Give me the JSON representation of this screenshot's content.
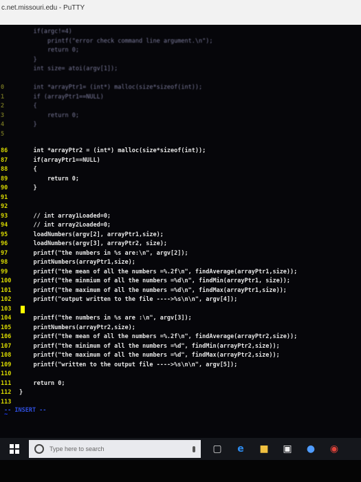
{
  "window": {
    "title": "c.net.missouri.edu - PuTTY"
  },
  "faded_lines": [
    {
      "ln": "",
      "text": "    if(argc!=4)"
    },
    {
      "ln": "",
      "text": "        printf(\"error check command line argument.\\n\");"
    },
    {
      "ln": "",
      "text": "        return 0;"
    },
    {
      "ln": "",
      "text": "    }"
    },
    {
      "ln": "",
      "text": "    int size= atoi(argv[1]);"
    },
    {
      "ln": "",
      "text": ""
    },
    {
      "ln": "0",
      "text": "    int *arrayPtr1= (int*) malloc(size*sizeof(int));"
    },
    {
      "ln": "1",
      "text": "    if (arrayPtr1==NULL)"
    },
    {
      "ln": "2",
      "text": "    {"
    },
    {
      "ln": "3",
      "text": "        return 0;"
    },
    {
      "ln": "4",
      "text": "    }"
    },
    {
      "ln": "5",
      "text": ""
    }
  ],
  "lines": [
    {
      "ln": "86",
      "text": "    int *arrayPtr2 = (int*) malloc(size*sizeof(int));"
    },
    {
      "ln": "87",
      "text": "    if(arrayPtr1==NULL)"
    },
    {
      "ln": "88",
      "text": "    {"
    },
    {
      "ln": "89",
      "text": "        return 0;"
    },
    {
      "ln": "90",
      "text": "    }"
    },
    {
      "ln": "91",
      "text": ""
    },
    {
      "ln": "92",
      "text": ""
    },
    {
      "ln": "93",
      "text": "    // int array1Loaded=0;"
    },
    {
      "ln": "94",
      "text": "    // int array2Loaded=0;"
    },
    {
      "ln": "95",
      "text": "    loadNumbers(argv[2], arrayPtr1,size);"
    },
    {
      "ln": "96",
      "text": "    loadNumbers(argv[3], arrayPtr2, size);"
    },
    {
      "ln": "97",
      "text": "    printf(\"the numbers in %s are:\\n\", argv[2]);"
    },
    {
      "ln": "98",
      "text": "    printNumbers(arrayPtr1,size);"
    },
    {
      "ln": "99",
      "text": "    printf(\"the mean of all the numbers =%.2f\\n\", findAverage(arrayPtr1,size));"
    },
    {
      "ln": "100",
      "text": "    printf(\"the minmium of all the numbers =%d\\n\", findMin(arrayPtr1, size));"
    },
    {
      "ln": "101",
      "text": "    printf(\"the maximum of all the numbers =%d\\n\", findMax(arrayPtr1,size));"
    },
    {
      "ln": "102",
      "text": "    printf(\"output written to the file ---->%s\\n\\n\", argv[4]);"
    },
    {
      "ln": "103",
      "text": ""
    },
    {
      "ln": "104",
      "text": "    printf(\"the numbers in %s are :\\n\", argv[3]);"
    },
    {
      "ln": "105",
      "text": "    printNumbers(arrayPtr2,size);"
    },
    {
      "ln": "106",
      "text": "    printf(\"the mean of all the numbers =%.2f\\n\", findAverage(arrayPtr2,size));"
    },
    {
      "ln": "107",
      "text": "    printf(\"the minimum of all the numbers =%d\", findMin(arrayPtr2,size));"
    },
    {
      "ln": "108",
      "text": "    printf(\"the maximum of all the numbers =%d\", findMax(arrayPtr2,size));"
    },
    {
      "ln": "109",
      "text": "    printf(\"written to the output file ---->%s\\n\\n\", argv[5]);"
    },
    {
      "ln": "110",
      "text": ""
    },
    {
      "ln": "111",
      "text": "    return 0;"
    },
    {
      "ln": "112",
      "text": "}"
    },
    {
      "ln": "113",
      "text": ""
    }
  ],
  "cursor_line": "103",
  "tilde_char": "~",
  "status": "-- INSERT --",
  "taskbar": {
    "search_placeholder": "Type here to search",
    "icons": [
      "windows-icon",
      "task-view-icon",
      "edge-icon",
      "file-explorer-icon",
      "store-icon",
      "app-icon",
      "chrome-icon"
    ]
  }
}
